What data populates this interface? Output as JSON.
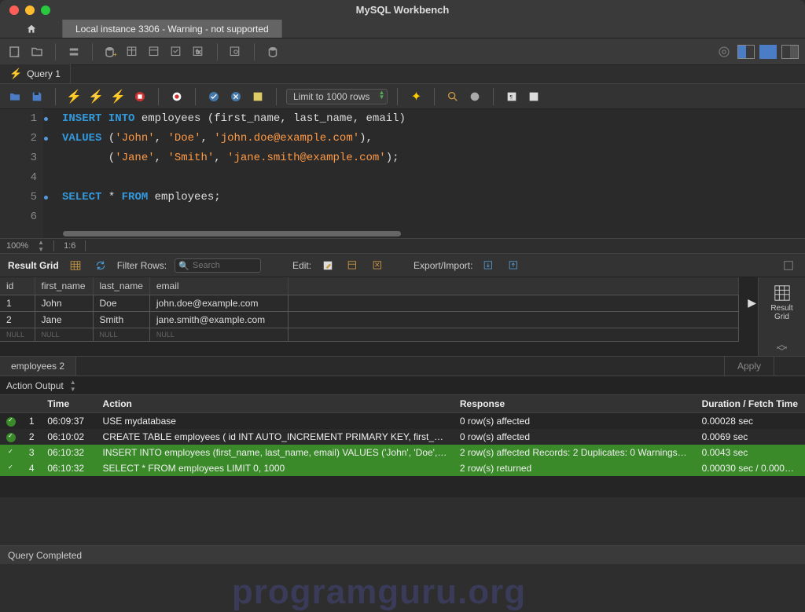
{
  "window": {
    "title": "MySQL Workbench"
  },
  "conn_tab": "Local instance 3306 - Warning - not supported",
  "query_tab": "Query 1",
  "limit_select": "Limit to 1000 rows",
  "editor": {
    "lines": [
      [
        {
          "c": "kw",
          "t": "INSERT INTO"
        },
        {
          "c": "ident",
          "t": " employees "
        },
        {
          "c": "punct",
          "t": "("
        },
        {
          "c": "ident",
          "t": "first_name"
        },
        {
          "c": "punct",
          "t": ", "
        },
        {
          "c": "ident",
          "t": "last_name"
        },
        {
          "c": "punct",
          "t": ", "
        },
        {
          "c": "ident",
          "t": "email"
        },
        {
          "c": "punct",
          "t": ")"
        }
      ],
      [
        {
          "c": "kw",
          "t": "VALUES"
        },
        {
          "c": "punct",
          "t": " ("
        },
        {
          "c": "str",
          "t": "'John'"
        },
        {
          "c": "punct",
          "t": ", "
        },
        {
          "c": "str",
          "t": "'Doe'"
        },
        {
          "c": "punct",
          "t": ", "
        },
        {
          "c": "str",
          "t": "'john.doe@example.com'"
        },
        {
          "c": "punct",
          "t": "),"
        }
      ],
      [
        {
          "c": "punct",
          "t": "       ("
        },
        {
          "c": "str",
          "t": "'Jane'"
        },
        {
          "c": "punct",
          "t": ", "
        },
        {
          "c": "str",
          "t": "'Smith'"
        },
        {
          "c": "punct",
          "t": ", "
        },
        {
          "c": "str",
          "t": "'jane.smith@example.com'"
        },
        {
          "c": "punct",
          "t": ");"
        }
      ],
      [],
      [
        {
          "c": "kw",
          "t": "SELECT"
        },
        {
          "c": "punct",
          "t": " * "
        },
        {
          "c": "kw",
          "t": "FROM"
        },
        {
          "c": "ident",
          "t": " employees"
        },
        {
          "c": "punct",
          "t": ";"
        }
      ],
      []
    ],
    "dot_rows": [
      0,
      1,
      4
    ]
  },
  "status": {
    "zoom": "100%",
    "pos": "1:6"
  },
  "result_tb": {
    "label": "Result Grid",
    "filter_label": "Filter Rows:",
    "filter_placeholder": "Search",
    "edit_label": "Edit:",
    "export_label": "Export/Import:"
  },
  "grid": {
    "columns": [
      "id",
      "first_name",
      "last_name",
      "email"
    ],
    "rows": [
      [
        "1",
        "John",
        "Doe",
        "john.doe@example.com"
      ],
      [
        "2",
        "Jane",
        "Smith",
        "jane.smith@example.com"
      ]
    ],
    "null_row": [
      "NULL",
      "NULL",
      "NULL",
      "NULL"
    ]
  },
  "side_tab": "Result Grid",
  "result_tab": "employees 2",
  "apply": "Apply",
  "ao_label": "Action Output",
  "ao_cols": {
    "time": "Time",
    "action": "Action",
    "response": "Response",
    "duration": "Duration / Fetch Time"
  },
  "ao_rows": [
    {
      "n": "1",
      "time": "06:09:37",
      "action": "USE mydatabase",
      "resp": "0 row(s) affected",
      "dur": "0.00028 sec",
      "green": false
    },
    {
      "n": "2",
      "time": "06:10:02",
      "action": "CREATE TABLE employees (     id INT AUTO_INCREMENT PRIMARY KEY,     first_n…",
      "resp": "0 row(s) affected",
      "dur": "0.0069 sec",
      "green": false
    },
    {
      "n": "3",
      "time": "06:10:32",
      "action": "INSERT INTO employees (first_name, last_name, email) VALUES ('John', 'Doe', 'jo…",
      "resp": "2 row(s) affected Records: 2  Duplicates: 0  Warnings…",
      "dur": "0.0043 sec",
      "green": true
    },
    {
      "n": "4",
      "time": "06:10:32",
      "action": "SELECT * FROM employees LIMIT 0, 1000",
      "resp": "2 row(s) returned",
      "dur": "0.00030 sec / 0.000…",
      "green": true
    }
  ],
  "statusbar": "Query Completed",
  "watermark": "programguru.org"
}
